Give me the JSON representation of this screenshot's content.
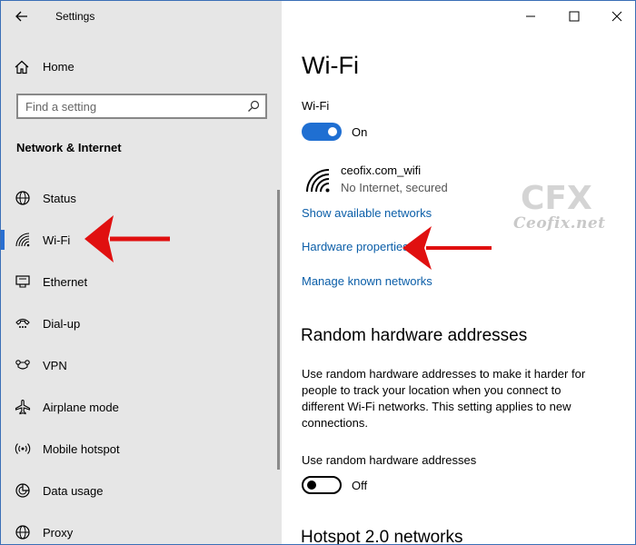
{
  "window": {
    "title": "Settings"
  },
  "sidebar": {
    "home": "Home",
    "search_placeholder": "Find a setting",
    "section": "Network & Internet",
    "items": [
      {
        "label": "Status",
        "icon": "globe-icon"
      },
      {
        "label": "Wi-Fi",
        "icon": "wifi-icon",
        "active": true
      },
      {
        "label": "Ethernet",
        "icon": "ethernet-icon"
      },
      {
        "label": "Dial-up",
        "icon": "dialup-icon"
      },
      {
        "label": "VPN",
        "icon": "vpn-icon"
      },
      {
        "label": "Airplane mode",
        "icon": "airplane-icon"
      },
      {
        "label": "Mobile hotspot",
        "icon": "hotspot-icon"
      },
      {
        "label": "Data usage",
        "icon": "data-usage-icon"
      },
      {
        "label": "Proxy",
        "icon": "globe-icon"
      }
    ]
  },
  "main": {
    "title": "Wi-Fi",
    "wifi_label": "Wi-Fi",
    "wifi_toggle": {
      "state": "On"
    },
    "network": {
      "name": "ceofix.com_wifi",
      "status": "No Internet, secured"
    },
    "links": [
      "Show available networks",
      "Hardware properties",
      "Manage known networks"
    ],
    "random_hw": {
      "heading": "Random hardware addresses",
      "description": "Use random hardware addresses to make it harder for people to track your location when you connect to different Wi-Fi networks. This setting applies to new connections.",
      "toggle_label": "Use random hardware addresses",
      "toggle_state": "Off"
    },
    "hotspot_heading": "Hotspot 2.0 networks"
  },
  "watermark": {
    "logo": "CFX",
    "text": "Ceofix.net"
  },
  "colors": {
    "accent": "#1f6fd2",
    "link": "#0b5ea8",
    "sidebar_bg": "#e6e6e6",
    "arrow": "#e01010"
  }
}
